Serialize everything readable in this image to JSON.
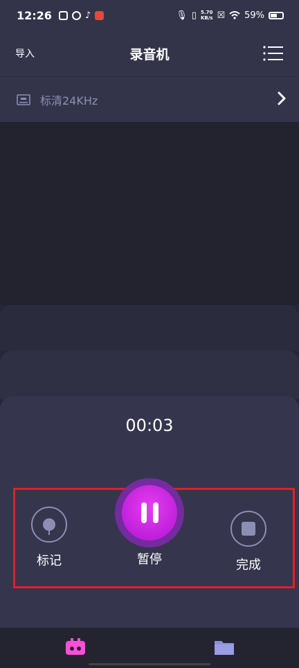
{
  "status_bar": {
    "time": "12:26",
    "net_speed_value": "5.70",
    "net_speed_unit": "KB/s",
    "battery": "59%"
  },
  "header": {
    "import_label": "导入",
    "title": "录音机",
    "menu_icon": "list-menu-icon"
  },
  "quality": {
    "icon": "quality-icon",
    "label": "标清24KHz"
  },
  "recorder": {
    "elapsed": "00:03"
  },
  "controls": {
    "mark_label": "标记",
    "pause_label": "暂停",
    "finish_label": "完成"
  },
  "bottom_nav": {
    "recorder_icon": "cassette-icon",
    "files_icon": "folder-icon"
  },
  "colors": {
    "accent": "#d52ee8",
    "highlight_box": "#e0202a",
    "nav_active": "#ff4fd8",
    "nav_inactive": "#8c8fd6"
  }
}
